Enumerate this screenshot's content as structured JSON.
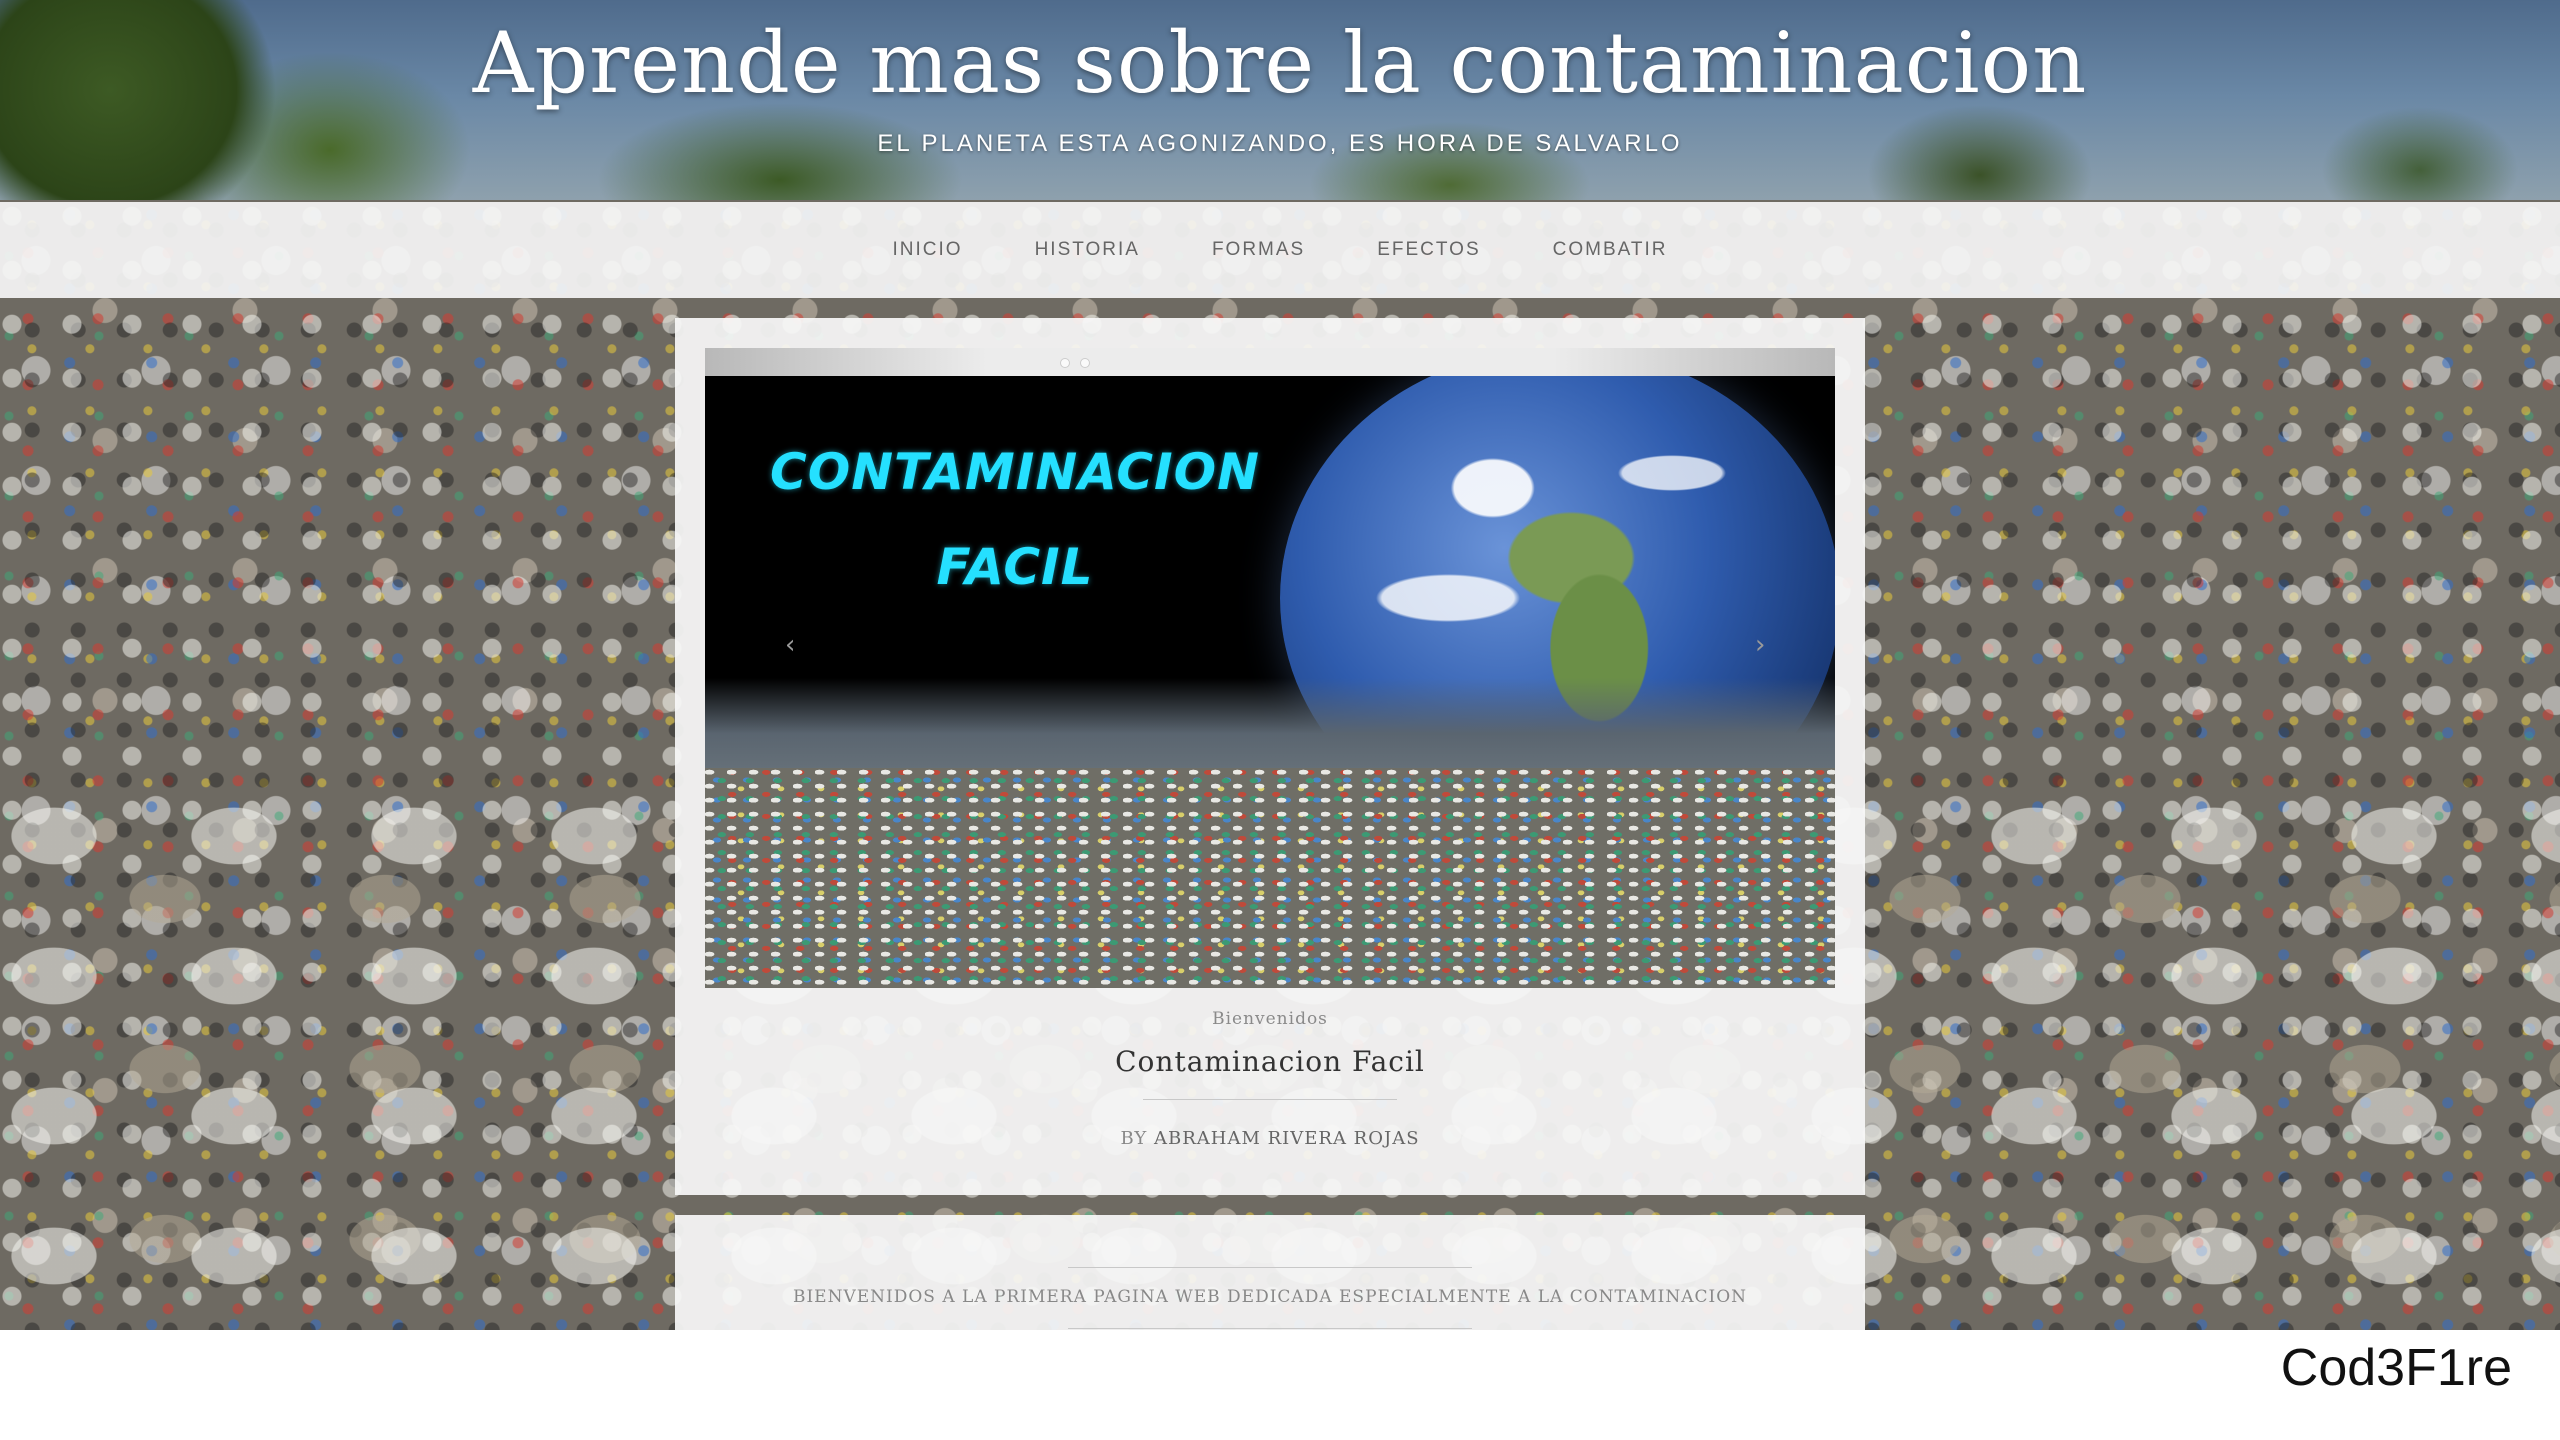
{
  "header": {
    "title": "Aprende mas sobre la contaminacion",
    "tagline": "EL PLANETA ESTA AGONIZANDO, ES HORA DE SALVARLO"
  },
  "nav": {
    "items": [
      {
        "label": "INICIO"
      },
      {
        "label": "HISTORIA"
      },
      {
        "label": "FORMAS"
      },
      {
        "label": "EFECTOS"
      },
      {
        "label": "COMBATIR"
      }
    ]
  },
  "slider": {
    "slide_line1": "CONTAMINACION",
    "slide_line2": "FACIL",
    "prev_icon": "chevron-left-icon",
    "next_icon": "chevron-right-icon",
    "prev_glyph": "‹",
    "next_glyph": "›"
  },
  "post": {
    "kicker": "Bienvenidos",
    "title": "Contaminacion Facil",
    "by_label": "BY",
    "author": "ABRAHAM RIVERA ROJAS"
  },
  "intro": {
    "text": "BIENVENIDOS A LA PRIMERA PAGINA WEB DEDICADA ESPECIALMENTE A LA CONTAMINACION"
  },
  "watermark": {
    "text": "Cod3F1re"
  },
  "colors": {
    "slide_title": "#25e0ff",
    "nav_bar": "#f5f5f5",
    "card_bg": "#f8f8f8"
  }
}
